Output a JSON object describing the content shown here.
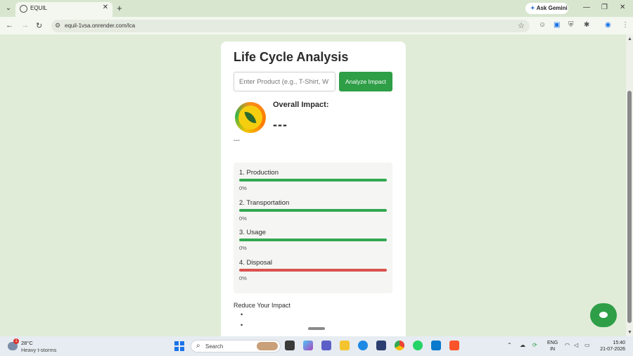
{
  "browser": {
    "tab_title": "EQUIL",
    "url": "equil-1vsa.onrender.com/lca",
    "ask_gemini": "Ask Gemini"
  },
  "page": {
    "title": "Life Cycle Analysis",
    "product_placeholder": "Enter Product (e.g., T-Shirt, W",
    "analyze_button": "Analyze Impact",
    "overall_label": "Overall Impact:",
    "overall_value": "---",
    "summary": "---",
    "stages": [
      {
        "name": "1. Production",
        "percent_label": "0%",
        "percent": 0,
        "color": "#34a853"
      },
      {
        "name": "2. Transportation",
        "percent_label": "0%",
        "percent": 0,
        "color": "#34a853"
      },
      {
        "name": "3. Usage",
        "percent_label": "0%",
        "percent": 0,
        "color": "#34a853"
      },
      {
        "name": "4. Disposal",
        "percent_label": "0%",
        "percent": 0,
        "color": "#d9534f"
      }
    ],
    "reduce_heading": "Reduce Your Impact",
    "accent_color": "#2e9e47"
  },
  "taskbar": {
    "weather_alert_count": "1",
    "temperature": "28°C",
    "condition": "Heavy t-storms",
    "search_label": "Search",
    "language_line1": "ENG",
    "language_line2": "IN",
    "time": "15:40",
    "date": "21-07-2026"
  }
}
